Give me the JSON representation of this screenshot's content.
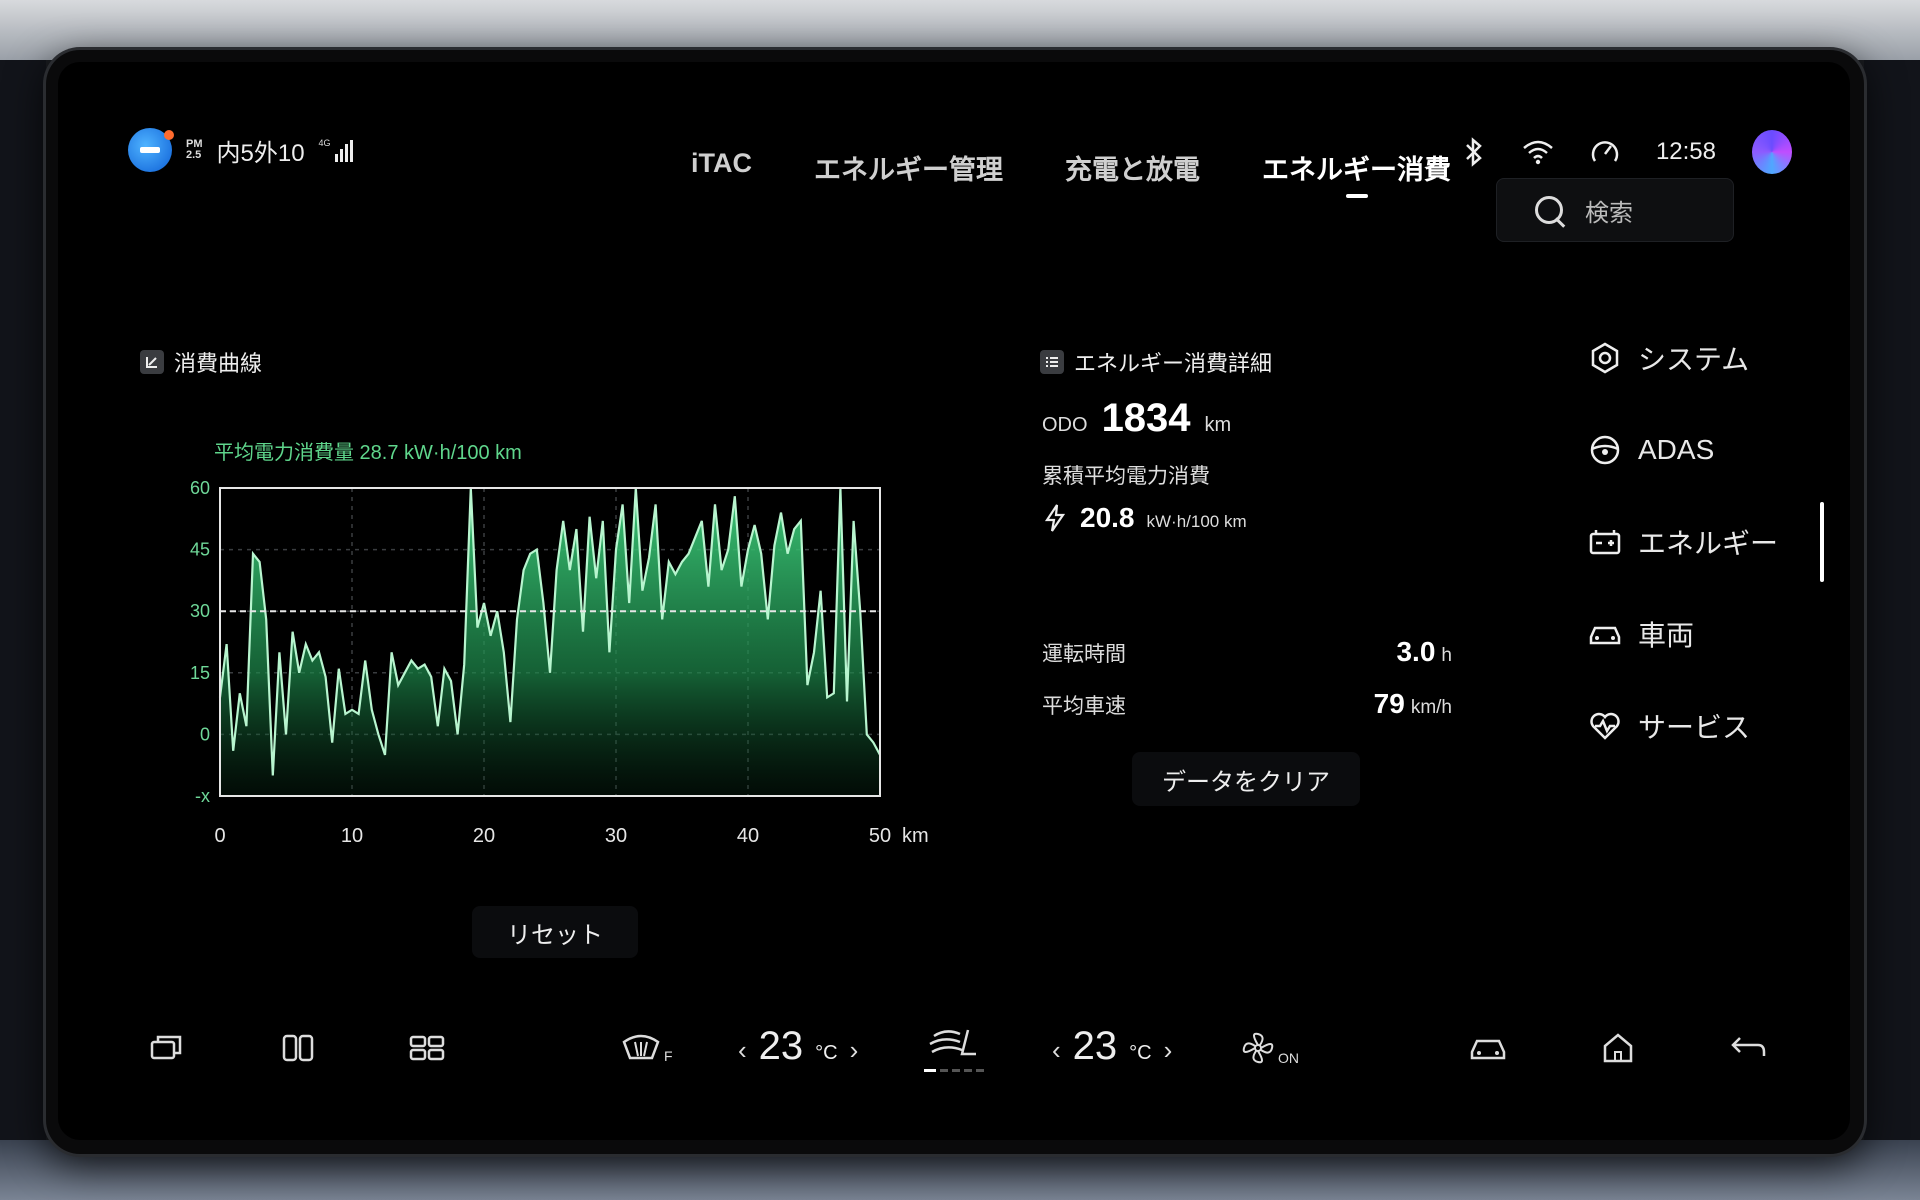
{
  "status": {
    "pm_label": "PM\n2.5",
    "air_text": "内5外10",
    "net_label": "4G",
    "time": "12:58"
  },
  "tabs": [
    {
      "label": "iTAC",
      "active": false
    },
    {
      "label": "エネルギー管理",
      "active": false
    },
    {
      "label": "充電と放電",
      "active": false
    },
    {
      "label": "エネルギー消費",
      "active": true
    }
  ],
  "search": {
    "placeholder": "検索"
  },
  "sidenav": [
    {
      "label": "システム",
      "icon": "hexagon-settings-icon"
    },
    {
      "label": "ADAS",
      "icon": "steering-wheel-icon"
    },
    {
      "label": "エネルギー",
      "icon": "battery-icon",
      "active": true
    },
    {
      "label": "車両",
      "icon": "car-icon"
    },
    {
      "label": "サービス",
      "icon": "heart-pulse-icon"
    }
  ],
  "curve": {
    "section_title": "消費曲線",
    "avg_label": "平均電力消費量 28.7 kW·h/100 km",
    "reset_label": "リセット"
  },
  "chart_data": {
    "type": "area",
    "xlabel": "km",
    "x_ticks": [
      "0",
      "10",
      "20",
      "30",
      "40",
      "50"
    ],
    "y_ticks": [
      "60",
      "45",
      "30",
      "15",
      "0",
      "-x"
    ],
    "xlim": [
      0,
      50
    ],
    "ylim": [
      -15,
      60
    ],
    "average_line": 30,
    "x": [
      0,
      0.5,
      1,
      1.5,
      2,
      2.5,
      3,
      3.5,
      4,
      4.5,
      5,
      5.5,
      6,
      6.5,
      7,
      7.5,
      8,
      8.5,
      9,
      9.5,
      10,
      10.5,
      11,
      11.5,
      12,
      12.5,
      13,
      13.5,
      14,
      14.5,
      15,
      15.5,
      16,
      16.5,
      17,
      17.5,
      18,
      18.5,
      19,
      19.5,
      20,
      20.5,
      21,
      21.5,
      22,
      22.5,
      23,
      23.5,
      24,
      24.5,
      25,
      25.5,
      26,
      26.5,
      27,
      27.5,
      28,
      28.5,
      29,
      29.5,
      30,
      30.5,
      31,
      31.5,
      32,
      32.5,
      33,
      33.5,
      34,
      34.5,
      35,
      35.5,
      36,
      36.5,
      37,
      37.5,
      38,
      38.5,
      39,
      39.5,
      40,
      40.5,
      41,
      41.5,
      42,
      42.5,
      43,
      43.5,
      44,
      44.5,
      45,
      45.5,
      46,
      46.5,
      47,
      47.5,
      48,
      48.5,
      49,
      49.5,
      50
    ],
    "y": [
      9,
      22,
      -4,
      10,
      2,
      44,
      42,
      28,
      -10,
      20,
      0,
      25,
      15,
      22,
      18,
      20,
      14,
      -2,
      16,
      5,
      6,
      5,
      18,
      6,
      0,
      -5,
      20,
      12,
      15,
      18,
      16,
      17,
      14,
      2,
      16,
      13,
      0,
      17,
      60,
      26,
      32,
      24,
      30,
      20,
      3,
      28,
      40,
      44,
      45,
      32,
      15,
      40,
      52,
      40,
      50,
      25,
      53,
      38,
      52,
      20,
      45,
      56,
      32,
      60,
      35,
      43,
      56,
      28,
      42,
      39,
      42,
      44,
      48,
      52,
      36,
      56,
      40,
      45,
      58,
      36,
      45,
      51,
      44,
      28,
      46,
      54,
      44,
      50,
      52,
      12,
      20,
      35,
      9,
      10,
      60,
      8,
      52,
      30,
      0,
      -2,
      -5
    ],
    "grid": true
  },
  "details": {
    "section_title": "エネルギー消費詳細",
    "odo_key": "ODO",
    "odo_value": "1834",
    "odo_unit": "km",
    "avg_key": "累積平均電力消費",
    "avg_value": "20.8",
    "avg_unit": "kW·h/100 km",
    "drive_time_key": "運転時間",
    "drive_time_value": "3.0",
    "drive_time_unit": "h",
    "avg_speed_key": "平均車速",
    "avg_speed_value": "79",
    "avg_speed_unit": "km/h",
    "clear_label": "データをクリア"
  },
  "dock": {
    "left_temp": "23",
    "right_temp": "23",
    "temp_unit": "°C",
    "defrost_label": "F",
    "fan_label": "ON"
  }
}
